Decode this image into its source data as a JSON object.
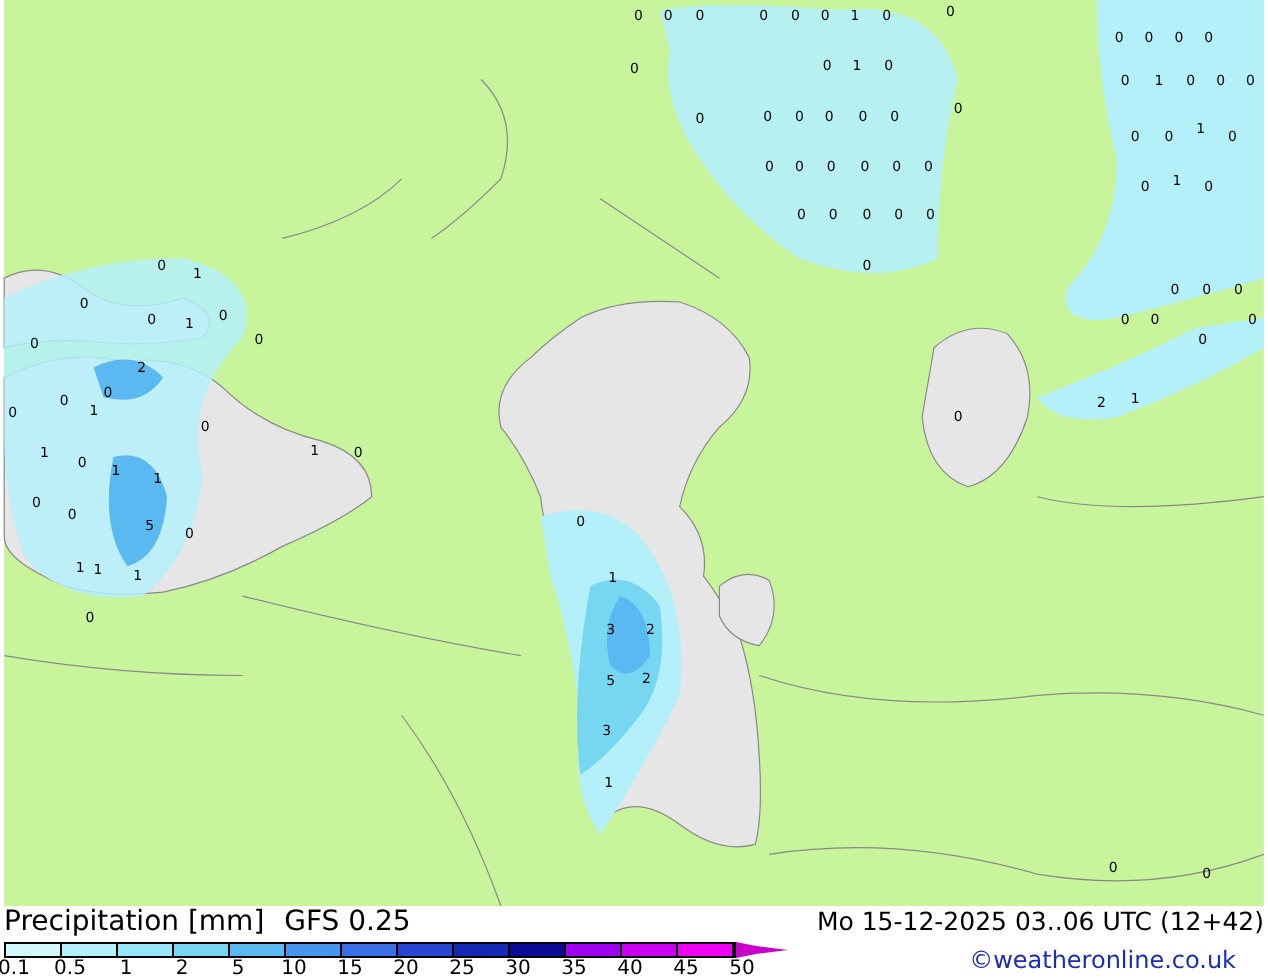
{
  "map": {
    "labels": [
      "0",
      "0",
      "0",
      "0",
      "0",
      "0",
      "1",
      "0",
      "0",
      "0",
      "0",
      "0",
      "0",
      "0",
      "0",
      "1",
      "0",
      "0",
      "1",
      "0",
      "0",
      "0",
      "0",
      "0",
      "0",
      "0",
      "0",
      "0",
      "0",
      "0",
      "0",
      "1",
      "0",
      "0",
      "0",
      "0",
      "0",
      "0",
      "0",
      "0",
      "1",
      "0",
      "0",
      "0",
      "0",
      "0",
      "0",
      "0",
      "1",
      "0",
      "0",
      "0",
      "0",
      "0",
      "0",
      "1",
      "0",
      "0",
      "0",
      "0",
      "0",
      "0",
      "0",
      "2",
      "0",
      "0",
      "1",
      "0",
      "0",
      "0",
      "2",
      "1",
      "1",
      "1",
      "0",
      "0",
      "1",
      "1",
      "0",
      "0",
      "5",
      "0",
      "0",
      "1",
      "1",
      "1",
      "1",
      "0",
      "3",
      "2",
      "5",
      "2",
      "3",
      "1",
      "0",
      "0"
    ]
  },
  "footer": {
    "title": "Precipitation [mm]",
    "model": "GFS 0.25",
    "datetime": "Mo 15-12-2025 03..06 UTC (12+42)",
    "credit": "©weatheronline.co.uk"
  },
  "legend": [
    {
      "label": "0.1",
      "color": "#d2fafa"
    },
    {
      "label": "0.5",
      "color": "#b4f0fa"
    },
    {
      "label": "1",
      "color": "#96e6fa"
    },
    {
      "label": "2",
      "color": "#78d7f0"
    },
    {
      "label": "5",
      "color": "#5ab9f0"
    },
    {
      "label": "10",
      "color": "#4696f0"
    },
    {
      "label": "15",
      "color": "#3c6ee6"
    },
    {
      "label": "20",
      "color": "#2846d2"
    },
    {
      "label": "25",
      "color": "#1428b4"
    },
    {
      "label": "30",
      "color": "#0a0a96"
    },
    {
      "label": "35",
      "color": "#a000f0"
    },
    {
      "label": "40",
      "color": "#c800f0"
    },
    {
      "label": "45",
      "color": "#f000f0"
    },
    {
      "label": "50",
      "color": "#c800c8"
    }
  ]
}
